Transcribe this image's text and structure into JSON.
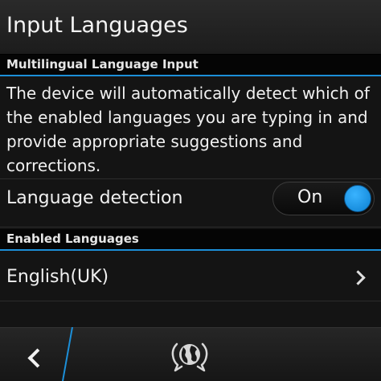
{
  "title_bar": {
    "title": "Input Languages"
  },
  "multilingual_section": {
    "header": "Multilingual Language Input",
    "description": "The device will automatically detect which of the enabled languages you are typing in and provide appropriate suggestions and corrections.",
    "language_detection": {
      "label": "Language detection",
      "toggle_label": "On",
      "enabled": true
    }
  },
  "enabled_languages_section": {
    "header": "Enabled Languages",
    "items": [
      {
        "label": "English(UK)"
      }
    ]
  },
  "bottom_bar": {
    "back_icon": "chevron-left-icon",
    "action_icon": "globe-chat-icon"
  },
  "colors": {
    "accent": "#1c8fd8",
    "background": "#141414",
    "section_header_bg": "#050505"
  }
}
